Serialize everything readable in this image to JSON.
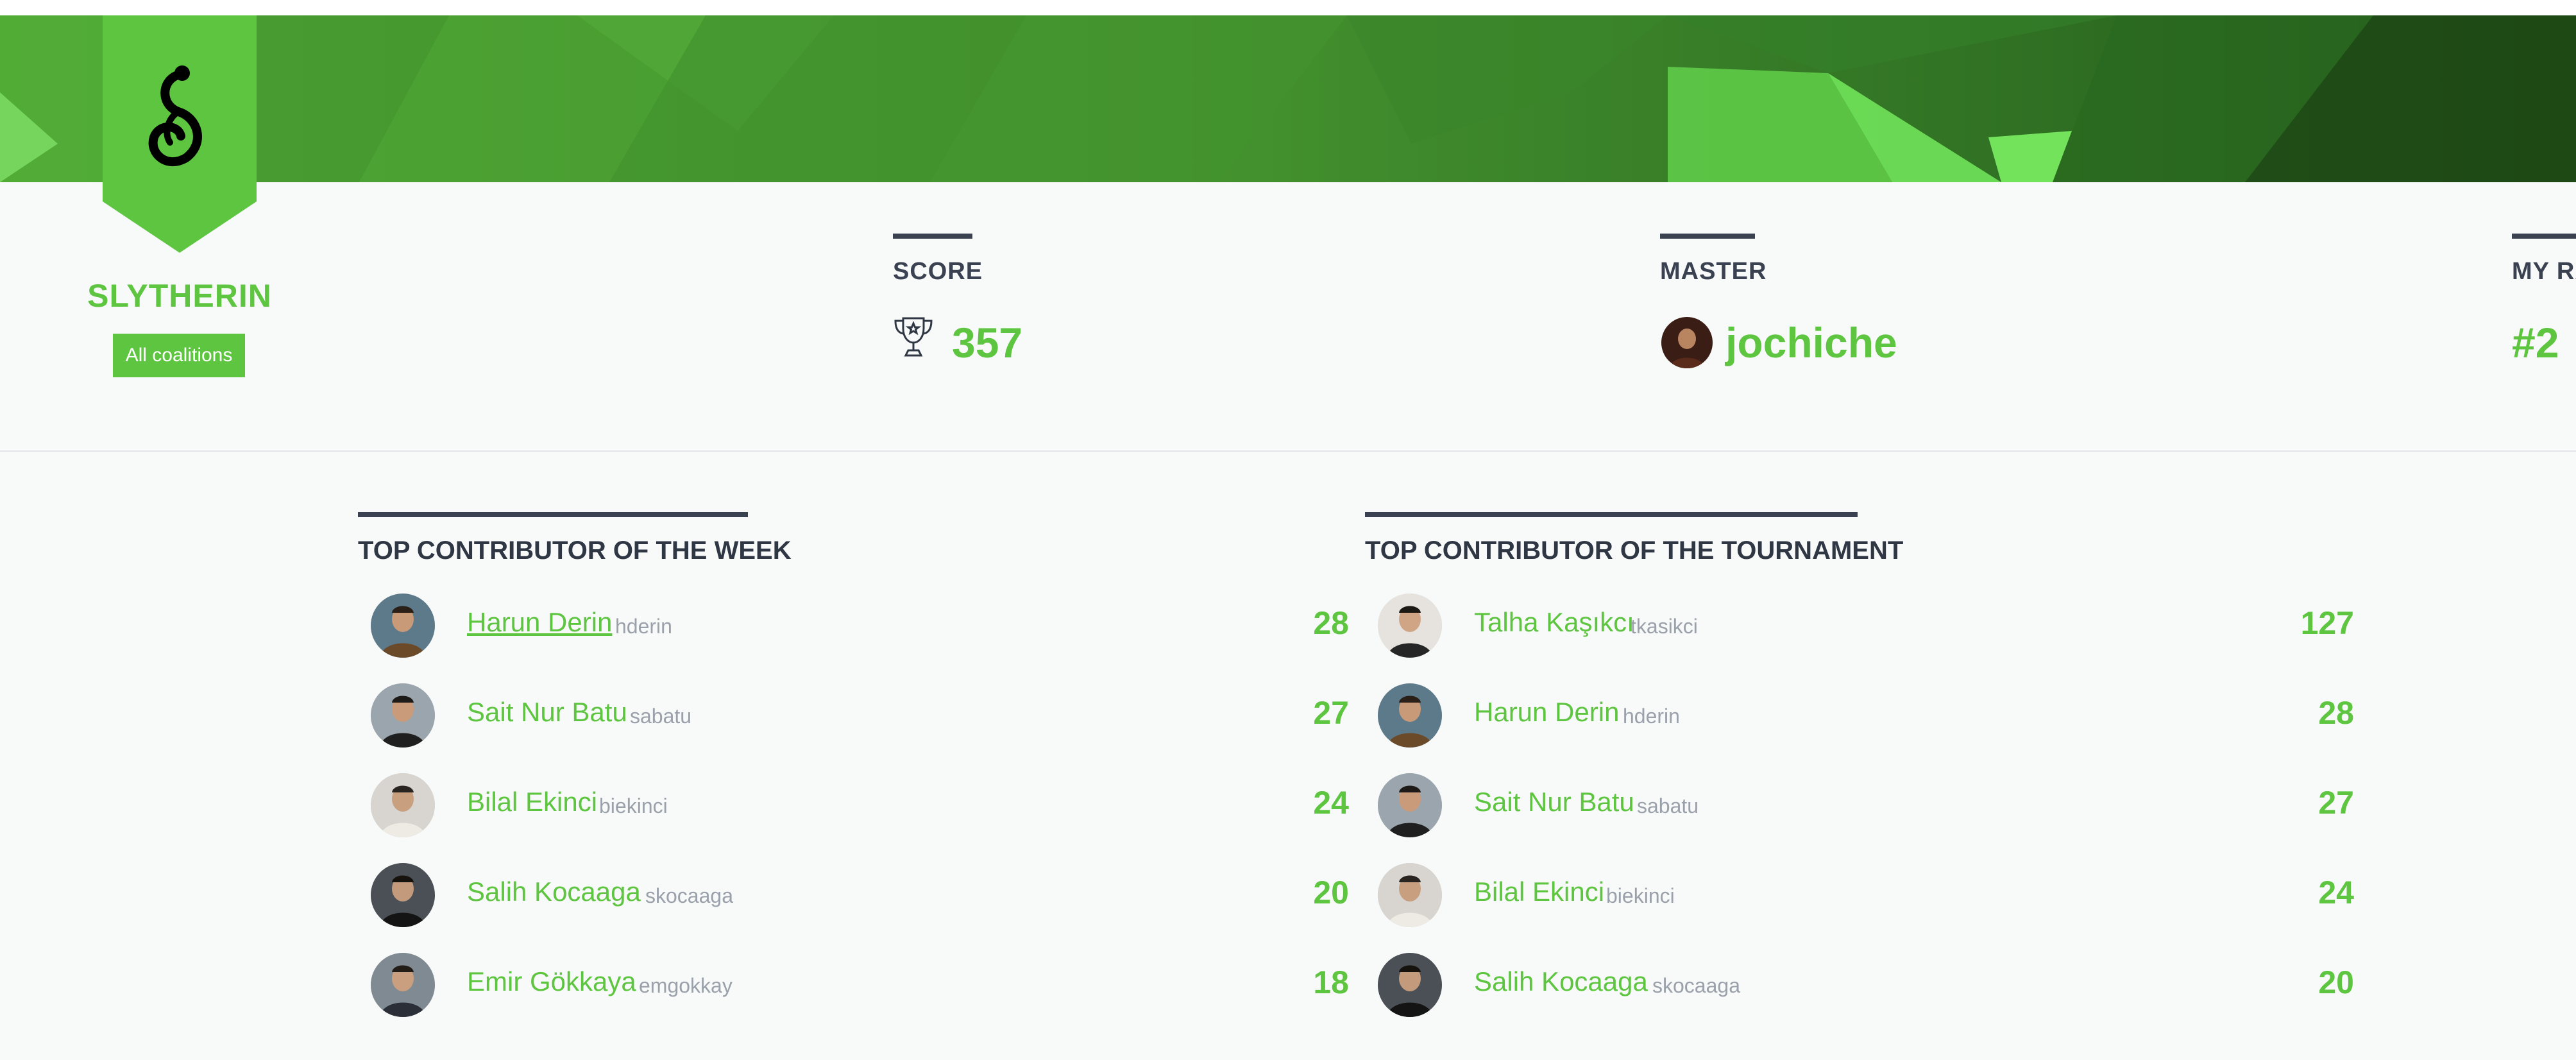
{
  "coalition": {
    "name": "SLYTHERIN",
    "all_button": "All coalitions",
    "emblem": "snake-icon",
    "color": "#5dc53f"
  },
  "stats": {
    "score": {
      "label": "SCORE",
      "value": "357",
      "icon": "trophy-icon"
    },
    "master": {
      "label": "MASTER",
      "value": "jochiche"
    },
    "rank": {
      "label": "MY RA",
      "value": "#2"
    }
  },
  "week": {
    "title": "TOP CONTRIBUTOR OF THE WEEK",
    "rows": [
      {
        "name": "Harun Derin",
        "login": "hderin",
        "score": "28"
      },
      {
        "name": "Sait Nur Batu",
        "login": "sabatu",
        "score": "27"
      },
      {
        "name": "Bilal Ekinci",
        "login": "biekinci",
        "score": "24"
      },
      {
        "name": "Salih Kocaaga",
        "login": "skocaaga",
        "score": "20"
      },
      {
        "name": "Emir Gökkaya",
        "login": "emgokkay",
        "score": "18"
      }
    ]
  },
  "tournament": {
    "title": "TOP CONTRIBUTOR OF THE TOURNAMENT",
    "rows": [
      {
        "name": "Talha Kaşıkcı",
        "login": "tkasikci",
        "score": "127"
      },
      {
        "name": "Harun Derin",
        "login": "hderin",
        "score": "28"
      },
      {
        "name": "Sait Nur Batu",
        "login": "sabatu",
        "score": "27"
      },
      {
        "name": "Bilal Ekinci",
        "login": "biekinci",
        "score": "24"
      },
      {
        "name": "Salih Kocaaga",
        "login": "skocaaga",
        "score": "20"
      }
    ]
  }
}
